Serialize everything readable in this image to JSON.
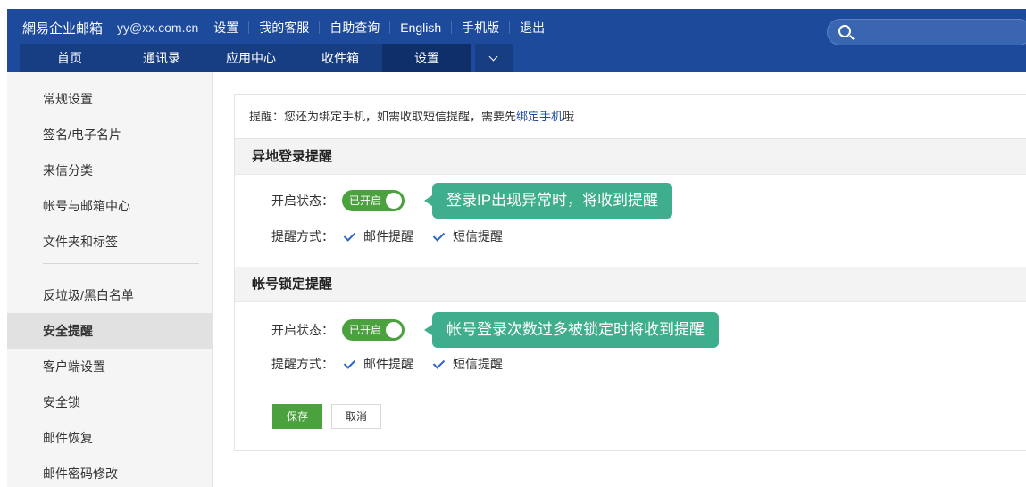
{
  "header": {
    "brand": "網易企业邮箱",
    "account": "yy@xx.com.cn",
    "links": [
      "设置",
      "我的客服",
      "自助查询",
      "English",
      "手机版",
      "退出"
    ]
  },
  "nav": {
    "tabs": [
      "首页",
      "通讯录",
      "应用中心",
      "收件箱",
      "设置"
    ],
    "more_icon": "chevron-down-icon"
  },
  "search": {
    "icon": "search-icon",
    "placeholder": ""
  },
  "sidebar": {
    "group1": [
      "常规设置",
      "签名/电子名片",
      "来信分类",
      "帐号与邮箱中心",
      "文件夹和标签"
    ],
    "group2": [
      "反垃圾/黑白名单",
      "安全提醒",
      "客户端设置",
      "安全锁",
      "邮件恢复",
      "邮件密码修改"
    ]
  },
  "notice": {
    "prefix": "提醒：您还为绑定手机，如需收取短信提醒，需要先",
    "link": "绑定手机",
    "suffix": "哦"
  },
  "sections": {
    "remote_login": {
      "title": "异地登录提醒",
      "status_label": "开启状态：",
      "toggle_text": "已开启",
      "method_label": "提醒方式：",
      "email_option": "邮件提醒",
      "sms_option": "短信提醒",
      "tooltip": "登录IP出现异常时，将收到提醒"
    },
    "account_lock": {
      "title": "帐号锁定提醒",
      "status_label": "开启状态：",
      "toggle_text": "已开启",
      "method_label": "提醒方式：",
      "email_option": "邮件提醒",
      "sms_option": "短信提醒",
      "tooltip": "帐号登录次数过多被锁定时将收到提醒"
    }
  },
  "buttons": {
    "save": "保存",
    "cancel": "取消"
  },
  "colors": {
    "header_bg": "#1d4a9b",
    "accent_green": "#4ca13f",
    "tooltip_bg": "#3fae8d",
    "link": "#1d4a9b"
  }
}
